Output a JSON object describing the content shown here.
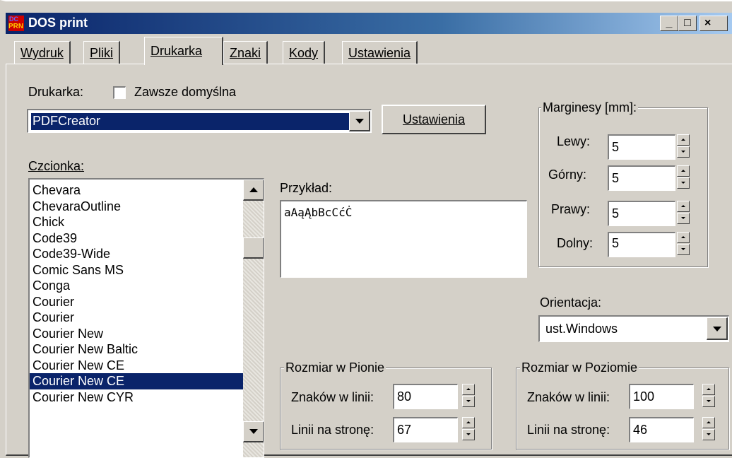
{
  "window": {
    "title": "DOS print",
    "icon_top": "DC",
    "icon_bottom": "PRN",
    "min_label": "_",
    "max_label": "□",
    "close_label": "×"
  },
  "tabs": [
    {
      "label": "Wydruk"
    },
    {
      "label": "Pliki"
    },
    {
      "label": "Drukarka"
    },
    {
      "label": "Znaki"
    },
    {
      "label": "Kody"
    },
    {
      "label": "Ustawienia"
    }
  ],
  "printer": {
    "label": "Drukarka:",
    "default_checkbox_label": "Zawsze domyślna",
    "default_checked": false,
    "selected": "PDFCreator",
    "settings_button": "Ustawienia"
  },
  "font": {
    "label": "Czcionka:",
    "items": [
      "Chevara",
      "ChevaraOutline",
      "Chick",
      "Code39",
      "Code39-Wide",
      "Comic Sans MS",
      "Conga",
      "Courier",
      "Courier",
      "Courier New",
      "Courier New Baltic",
      "Courier New CE",
      "Courier New CE",
      "Courier New CYR"
    ],
    "selected_index": 12
  },
  "preview": {
    "label": "Przykład:",
    "text": "aAąĄbBcCćĊ"
  },
  "margins": {
    "title": "Marginesy [mm]:",
    "left_label": "Lewy:",
    "left_value": "5",
    "top_label": "Górny:",
    "top_value": "5",
    "right_label": "Prawy:",
    "right_value": "5",
    "bottom_label": "Dolny:",
    "bottom_value": "5"
  },
  "orientation": {
    "label": "Orientacja:",
    "selected": "ust.Windows"
  },
  "vertical": {
    "title": "Rozmiar w Pionie",
    "chars_label": "Znaków w linii:",
    "chars_value": "80",
    "lines_label": "Linii na stronę:",
    "lines_value": "67"
  },
  "horizontal": {
    "title": "Rozmiar w Poziomie",
    "chars_label": "Znaków w linii:",
    "chars_value": "100",
    "lines_label": "Linii na stronę:",
    "lines_value": "46"
  },
  "colors": {
    "titlebar_start": "#0a246a",
    "titlebar_end": "#a6caf0",
    "selection": "#0a246a",
    "face": "#d4d0c8"
  }
}
